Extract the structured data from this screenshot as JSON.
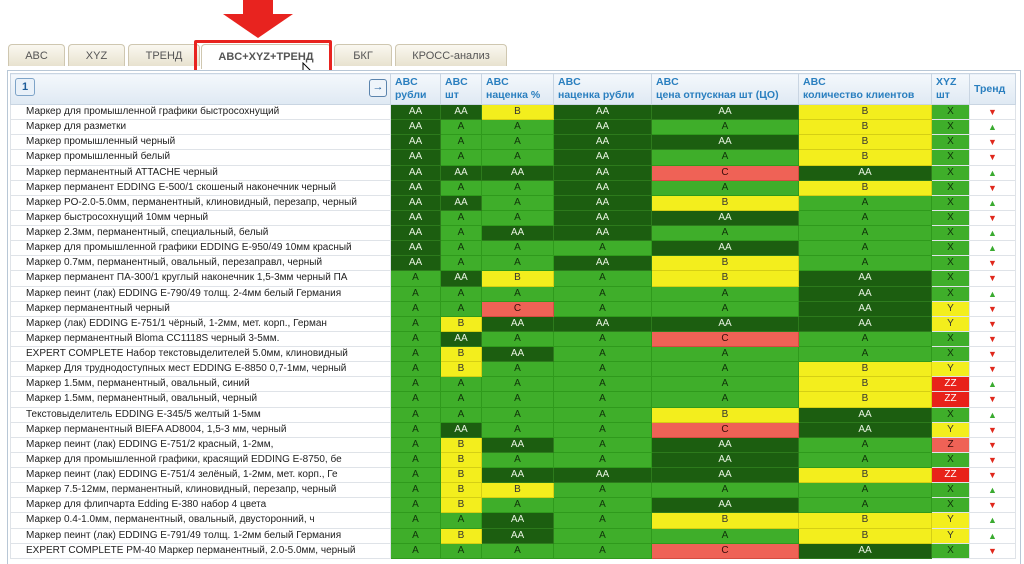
{
  "tabs": [
    "ABC",
    "XYZ",
    "ТРЕНД",
    "ABC+XYZ+ТРЕНД",
    "БКГ",
    "КРОСС-анализ"
  ],
  "page_button": "1",
  "go_icon": "→",
  "columns": [
    {
      "line1": "ABC",
      "line2": "рубли"
    },
    {
      "line1": "ABC",
      "line2": "шт"
    },
    {
      "line1": "ABC",
      "line2": "наценка %"
    },
    {
      "line1": "ABC",
      "line2": "наценка рубли"
    },
    {
      "line1": "ABC",
      "line2": "цена отпускная шт (ЦО)"
    },
    {
      "line1": "ABC",
      "line2": "количество клиентов"
    },
    {
      "line1": "XYZ",
      "line2": "шт"
    },
    {
      "line1": "Тренд",
      "line2": ""
    }
  ],
  "colors": {
    "AA": "#1c5e10",
    "A": "#3fae2a",
    "B": "#f3ee1d",
    "C": "#ef6256",
    "ZZ": "#e8221a",
    "trend_up": "#3aaa30",
    "trend_down": "#e0281c",
    "highlight": "#e8231f"
  },
  "rows": [
    {
      "name": "Маркер для промышленной графики быстросохнущий",
      "v": [
        "AA",
        "AA",
        "B",
        "AA",
        "AA",
        "B",
        "X"
      ],
      "trend": "down"
    },
    {
      "name": "Маркер для разметки",
      "v": [
        "AA",
        "A",
        "A",
        "AA",
        "A",
        "B",
        "X"
      ],
      "trend": "up"
    },
    {
      "name": "Маркер промышленный черный",
      "v": [
        "AA",
        "A",
        "A",
        "AA",
        "AA",
        "B",
        "X"
      ],
      "trend": "down"
    },
    {
      "name": "Маркер промышленный белый",
      "v": [
        "AA",
        "A",
        "A",
        "AA",
        "A",
        "B",
        "X"
      ],
      "trend": "down"
    },
    {
      "name": "Маркер перманентный ATTACHE черный",
      "v": [
        "AA",
        "AA",
        "AA",
        "AA",
        "C",
        "AA",
        "X"
      ],
      "trend": "up"
    },
    {
      "name": "Маркер перманент EDDING E-500/1 скошеный наконечник черный",
      "v": [
        "AA",
        "A",
        "A",
        "AA",
        "A",
        "B",
        "X"
      ],
      "trend": "down"
    },
    {
      "name": "Маркер PO-2.0-5.0мм, перманентный, клиновидный, перезапр, черный",
      "v": [
        "AA",
        "AA",
        "A",
        "AA",
        "B",
        "A",
        "X"
      ],
      "trend": "up"
    },
    {
      "name": "Маркер быстросохнущий 10мм черный",
      "v": [
        "AA",
        "A",
        "A",
        "AA",
        "AA",
        "A",
        "X"
      ],
      "trend": "down"
    },
    {
      "name": "Маркер 2.3мм, перманентный, специальный, белый",
      "v": [
        "AA",
        "A",
        "AA",
        "AA",
        "A",
        "A",
        "X"
      ],
      "trend": "up"
    },
    {
      "name": "Маркер для промышленной графики EDDING E-950/49 10мм красный",
      "v": [
        "AA",
        "A",
        "A",
        "A",
        "AA",
        "A",
        "X"
      ],
      "trend": "up"
    },
    {
      "name": "Маркер 0.7мм, перманентный, овальный, перезаправл, черный",
      "v": [
        "AA",
        "A",
        "A",
        "AA",
        "B",
        "A",
        "X"
      ],
      "trend": "down"
    },
    {
      "name": "Маркер перманент ПА-300/1 круглый наконечник 1,5-3мм черный ПА",
      "v": [
        "A",
        "AA",
        "B",
        "A",
        "B",
        "AA",
        "X"
      ],
      "trend": "down"
    },
    {
      "name": "Маркер пеинт (лак) EDDING E-790/49 толщ. 2-4мм белый Германия",
      "v": [
        "A",
        "A",
        "A",
        "A",
        "A",
        "AA",
        "X"
      ],
      "trend": "up"
    },
    {
      "name": "Маркер перманентный черный",
      "v": [
        "A",
        "A",
        "C",
        "A",
        "A",
        "AA",
        "Y"
      ],
      "trend": "down"
    },
    {
      "name": "Маркер (лак) EDDING E-751/1 чёрный, 1-2мм, мет. корп., Герман",
      "v": [
        "A",
        "B",
        "AA",
        "AA",
        "AA",
        "AA",
        "Y"
      ],
      "trend": "down"
    },
    {
      "name": " Маркер перманентный Bloma CC1118S черный 3-5мм.",
      "v": [
        "A",
        "AA",
        "A",
        "A",
        "C",
        "A",
        "X"
      ],
      "trend": "down"
    },
    {
      "name": "EXPERT COMPLETE Набор текстовыделителей 5.0мм, клиновидный",
      "v": [
        "A",
        "B",
        "AA",
        "A",
        "A",
        "A",
        "X"
      ],
      "trend": "down"
    },
    {
      "name": "Маркер Для труднодоступных мест EDDING E-8850 0,7-1мм, черный",
      "v": [
        "A",
        "B",
        "A",
        "A",
        "A",
        "B",
        "Y"
      ],
      "trend": "down"
    },
    {
      "name": "Маркер 1.5мм, перманентный, овальный, синий",
      "v": [
        "A",
        "A",
        "A",
        "A",
        "A",
        "B",
        "ZZ"
      ],
      "trend": "up"
    },
    {
      "name": "Маркер 1.5мм, перманентный, овальный, черный",
      "v": [
        "A",
        "A",
        "A",
        "A",
        "A",
        "B",
        "ZZ"
      ],
      "trend": "down"
    },
    {
      "name": "Текстовыделитель EDDING E-345/5 желтый 1-5мм",
      "v": [
        "A",
        "A",
        "A",
        "A",
        "B",
        "AA",
        "X"
      ],
      "trend": "up"
    },
    {
      "name": "Маркер перманентный BIEFA AD8004, 1,5-3 мм, черный",
      "v": [
        "A",
        "AA",
        "A",
        "A",
        "C",
        "AA",
        "Y"
      ],
      "trend": "down"
    },
    {
      "name": "Маркер пеинт (лак) EDDING E-751/2 красный, 1-2мм,",
      "v": [
        "A",
        "B",
        "AA",
        "A",
        "AA",
        "A",
        "Z"
      ],
      "trend": "down"
    },
    {
      "name": "Маркер для промышленной графики, красящий  EDDING E-8750, бе",
      "v": [
        "A",
        "B",
        "A",
        "A",
        "AA",
        "A",
        "X"
      ],
      "trend": "down"
    },
    {
      "name": "Маркер пеинт (лак) EDDING E-751/4 зелёный, 1-2мм, мет. корп., Ге",
      "v": [
        "A",
        "B",
        "AA",
        "AA",
        "AA",
        "B",
        "ZZ"
      ],
      "trend": "down"
    },
    {
      "name": " Маркер 7.5-12мм, перманентный, клиновидный, перезапр, черный",
      "v": [
        "A",
        "B",
        "B",
        "A",
        "A",
        "A",
        "X"
      ],
      "trend": "up"
    },
    {
      "name": "Маркер для флипчарта Edding E-380  набор 4 цвета",
      "v": [
        "A",
        "B",
        "A",
        "A",
        "AA",
        "A",
        "X"
      ],
      "trend": "down"
    },
    {
      "name": "Маркер 0.4-1.0мм, перманентный, овальный, двусторонний, ч",
      "v": [
        "A",
        "A",
        "AA",
        "A",
        "B",
        "B",
        "Y"
      ],
      "trend": "up"
    },
    {
      "name": "Маркер пеинт (лак) EDDING E-791/49 толщ. 1-2мм белый Германия",
      "v": [
        "A",
        "B",
        "AA",
        "A",
        "A",
        "B",
        "Y"
      ],
      "trend": "up"
    },
    {
      "name": "EXPERT COMPLETE PM-40 Маркер перманентный, 2.0-5.0мм, черный",
      "v": [
        "A",
        "A",
        "A",
        "A",
        "C",
        "AA",
        "X"
      ],
      "trend": "down"
    }
  ]
}
